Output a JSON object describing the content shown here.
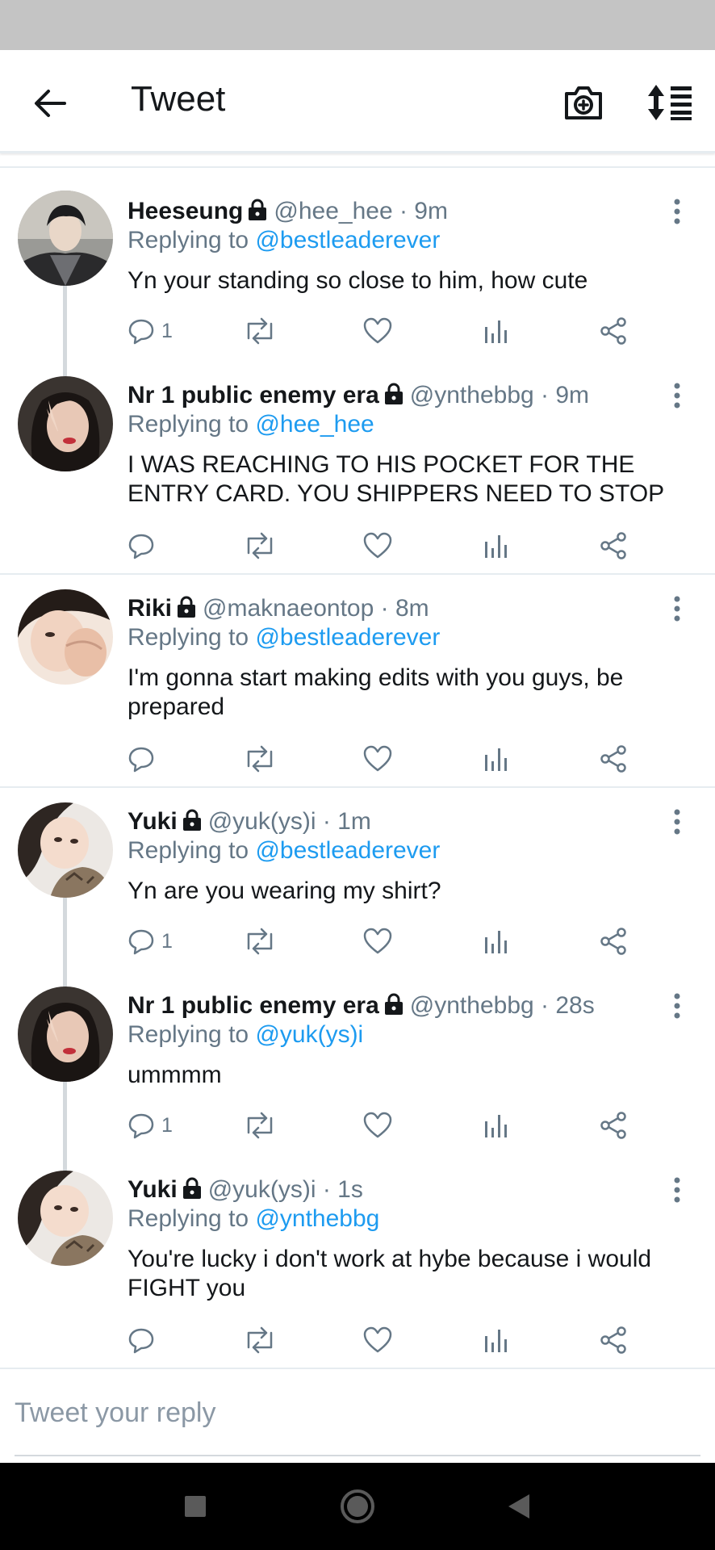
{
  "header": {
    "title": "Tweet",
    "back_icon": "arrow-left-icon",
    "camera_icon": "camera-icon",
    "sort_icon": "sort-icon"
  },
  "tweets": [
    {
      "name": "Heeseung",
      "handle": "@hee_hee",
      "time": "· 9m",
      "replying_prefix": "Replying to",
      "replying_to": "@bestleaderever",
      "text": "Yn your standing so close to him, how cute",
      "reply_count": "1"
    },
    {
      "name": "Nr 1 public enemy era",
      "handle": "@ynthebbg",
      "time": "· 9m",
      "replying_prefix": "Replying to",
      "replying_to": "@hee_hee",
      "text": "I WAS REACHING TO HIS POCKET FOR THE ENTRY CARD. YOU SHIPPERS NEED TO STOP",
      "reply_count": ""
    },
    {
      "name": "Riki",
      "handle": "@maknaeontop",
      "time": "· 8m",
      "replying_prefix": "Replying to",
      "replying_to": "@bestleaderever",
      "text": "I'm gonna start making edits with you guys, be prepared",
      "reply_count": ""
    },
    {
      "name": "Yuki",
      "handle": "@yuk(ys)i",
      "time": "· 1m",
      "replying_prefix": "Replying to",
      "replying_to": "@bestleaderever",
      "text": "Yn are you wearing my shirt?",
      "reply_count": "1"
    },
    {
      "name": "Nr 1 public enemy era",
      "handle": "@ynthebbg",
      "time": "· 28s",
      "replying_prefix": "Replying to",
      "replying_to": "@yuk(ys)i",
      "text": "ummmm",
      "reply_count": "1"
    },
    {
      "name": "Yuki",
      "handle": "@yuk(ys)i",
      "time": "· 1s",
      "replying_prefix": "Replying to",
      "replying_to": "@ynthebbg",
      "text": "You're lucky i don't work at hybe because i would FIGHT you",
      "reply_count": ""
    }
  ],
  "reply_box": {
    "placeholder": "Tweet your reply"
  },
  "colors": {
    "link": "#1d9bf0",
    "secondary_text": "#657786",
    "divider": "#e6ecf0",
    "status_bar": "#c4c4c4",
    "nav_bar": "#000000"
  }
}
